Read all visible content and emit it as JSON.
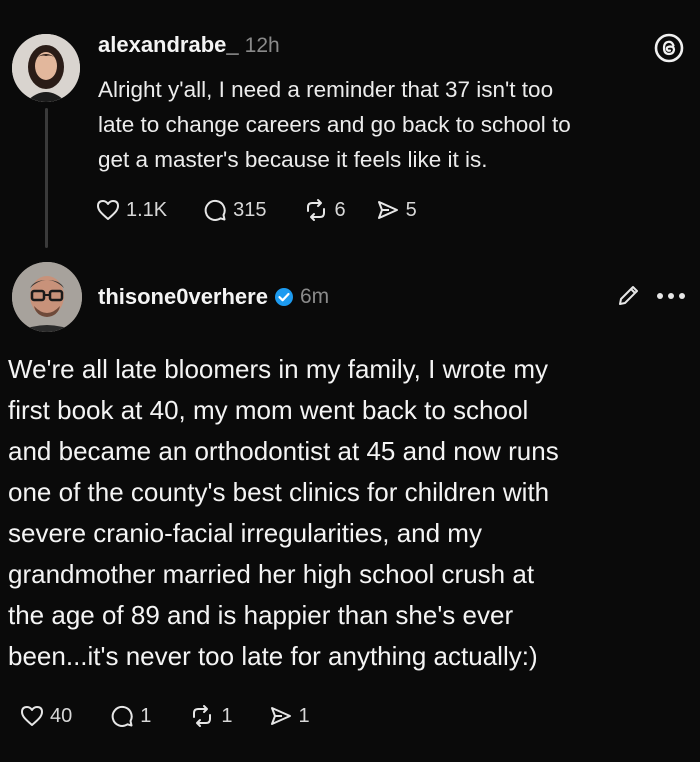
{
  "post1": {
    "username": "alexandrabe_",
    "time": "12h",
    "text": "Alright y'all, I need a reminder that 37 isn't too late to change careers and go back to school to get a master's because it feels like it is.",
    "lines": [
      "Alright y'all, I need a reminder that 37 isn't too",
      "late to change careers and go back to school to",
      "get a master's because it feels like it is."
    ],
    "likes": "1.1K",
    "replies": "315",
    "reposts": "6",
    "shares": "5"
  },
  "post2": {
    "username": "thisone0verhere",
    "time": "6m",
    "lines": [
      "We're all late bloomers in my family, I wrote my",
      "first book at 40, my mom went back to school",
      "and became an orthodontist at 45 and now runs",
      "one of the county's best clinics for children with",
      "severe cranio-facial irregularities, and my",
      "grandmother married her high school crush at",
      "the age of 89 and is happier than she's ever",
      "been...it's never too late for anything actually:)"
    ],
    "likes": "40",
    "replies": "1",
    "reposts": "1",
    "shares": "1"
  },
  "icons": {
    "threads_logo": "threads-logo-icon",
    "verified": "verified-badge-icon",
    "edit": "pencil-icon",
    "more": "more-icon",
    "like": "heart-icon",
    "reply": "comment-icon",
    "repost": "repost-icon",
    "share": "share-icon"
  },
  "colors": {
    "background": "#0a0a0a",
    "text": "#f2f2f2",
    "muted": "#8a8a8a",
    "verified": "#1d9bf0"
  }
}
